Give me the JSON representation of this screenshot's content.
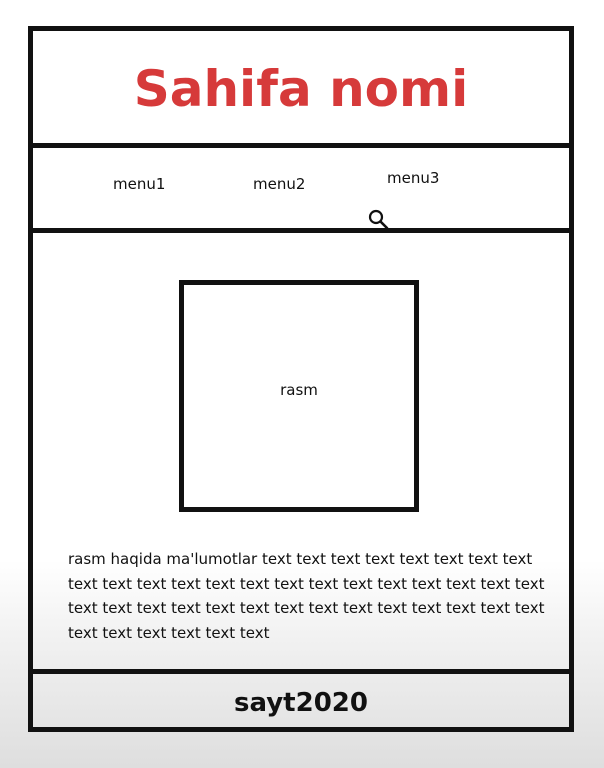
{
  "header": {
    "title": "Sahifa nomi",
    "title_color": "#d63a3a"
  },
  "nav": {
    "items": [
      {
        "label": "menu1"
      },
      {
        "label": "menu2"
      },
      {
        "label": "menu3"
      }
    ]
  },
  "cursor": {
    "icon": "magnifier-cursor-icon"
  },
  "main": {
    "image_label": "rasm",
    "description": "rasm haqida ma'lumotlar text text text text text text text text text text text text text text text text text text text text text text text text text text text text text text text text text text text text text text text text text text"
  },
  "footer": {
    "text": "sayt2020"
  }
}
